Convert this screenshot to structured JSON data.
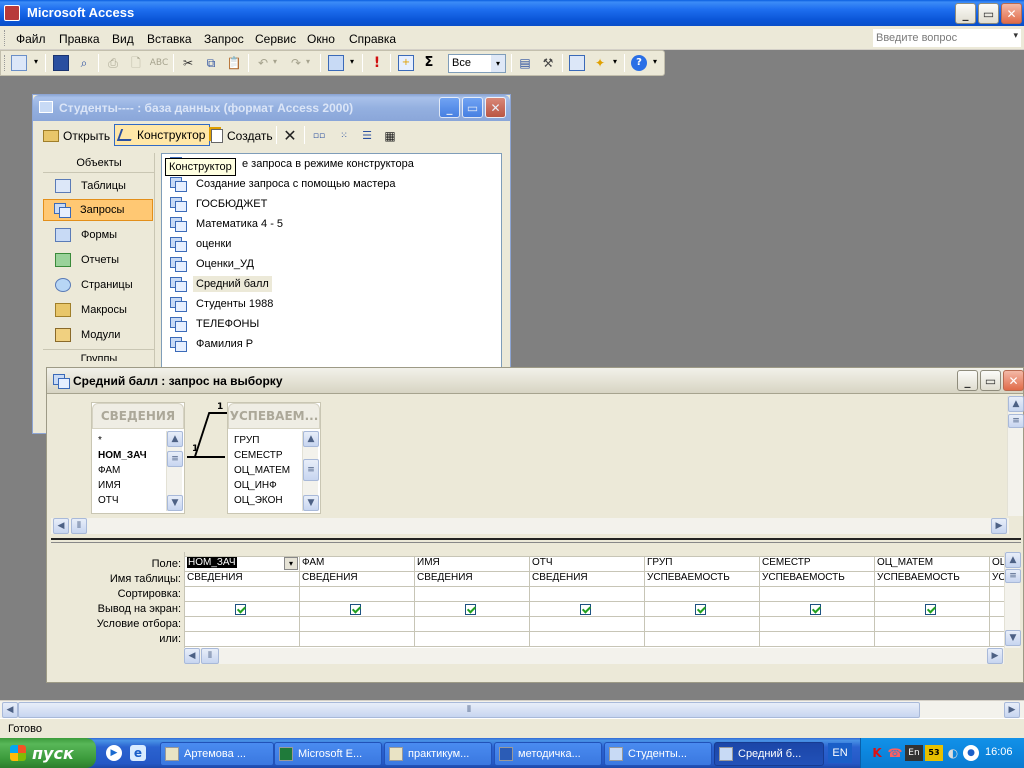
{
  "app": {
    "title": "Microsoft Access"
  },
  "menu": {
    "items": [
      "Файл",
      "Правка",
      "Вид",
      "Вставка",
      "Запрос",
      "Сервис",
      "Окно",
      "Справка"
    ],
    "help_placeholder": "Введите вопрос"
  },
  "toolbar": {
    "top_values_combo": "Все"
  },
  "db_window": {
    "title": "Студенты---- : база данных (формат Access 2000)",
    "toolbar": {
      "open": "Открыть",
      "design": "Конструктор",
      "create": "Создать"
    },
    "tooltip": "Конструктор",
    "objects_header": "Объекты",
    "objects": [
      "Таблицы",
      "Запросы",
      "Формы",
      "Отчеты",
      "Страницы",
      "Макросы",
      "Модули"
    ],
    "selected_object": "Запросы",
    "groups_partial": "Группы",
    "queries": [
      "Создание запроса в режиме конструктора",
      "Создание запроса с помощью мастера",
      "ГОСБЮДЖЕТ",
      "Математика 4 - 5",
      "оценки",
      "Оценки_УД",
      "Средний балл",
      "Студенты 1988",
      "ТЕЛЕФОНЫ",
      "Фамилия Р"
    ],
    "first_query_visible": "е запроса в режиме конструктора",
    "selected_query": "Средний балл"
  },
  "query_window": {
    "title": "Средний балл : запрос на выборку",
    "tables": [
      {
        "name": "СВЕДЕНИЯ",
        "fields": [
          "*",
          "НОМ_ЗАЧ",
          "ФАМ",
          "ИМЯ",
          "ОТЧ"
        ],
        "key_field": "НОМ_ЗАЧ"
      },
      {
        "name": "УСПЕВАЕМ...",
        "fields": [
          "ГРУП",
          "СЕМЕСТР",
          "ОЦ_МАТЕМ",
          "ОЦ_ИНФ",
          "ОЦ_ЭКОН"
        ]
      }
    ],
    "relation": {
      "left": "1",
      "right": "1"
    },
    "grid_labels": [
      "Поле:",
      "Имя таблицы:",
      "Сортировка:",
      "Вывод на экран:",
      "Условие отбора:",
      "или:"
    ],
    "columns": [
      {
        "field": "НОМ_ЗАЧ",
        "table": "СВЕДЕНИЯ",
        "show": true
      },
      {
        "field": "ФАМ",
        "table": "СВЕДЕНИЯ",
        "show": true
      },
      {
        "field": "ИМЯ",
        "table": "СВЕДЕНИЯ",
        "show": true
      },
      {
        "field": "ОТЧ",
        "table": "СВЕДЕНИЯ",
        "show": true
      },
      {
        "field": "ГРУП",
        "table": "УСПЕВАЕМОСТЬ",
        "show": true
      },
      {
        "field": "СЕМЕСТР",
        "table": "УСПЕВАЕМОСТЬ",
        "show": true
      },
      {
        "field": "ОЦ_МАТЕМ",
        "table": "УСПЕВАЕМОСТЬ",
        "show": true
      },
      {
        "field": "ОЦ",
        "table": "УС",
        "show": false
      }
    ]
  },
  "status": {
    "text": "Готово"
  },
  "taskbar": {
    "start": "пуск",
    "buttons": [
      "Артемова ...",
      "Microsoft E...",
      "практикум...",
      "методичка...",
      "Студенты...",
      "Средний б..."
    ],
    "active_button": "Средний б...",
    "language": "EN",
    "clock": "16:06",
    "tray_en": "En"
  }
}
